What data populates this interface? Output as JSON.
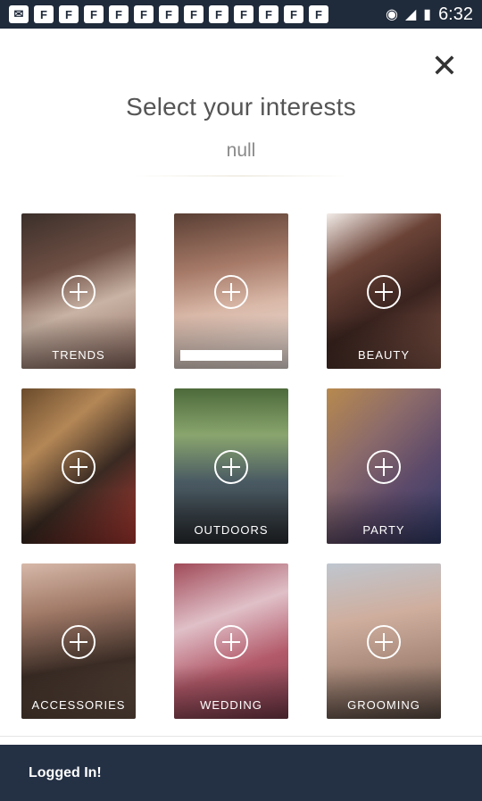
{
  "status_bar": {
    "time": "6:32",
    "notification_icons": [
      "mail-icon",
      "flipboard-icon",
      "flipboard-icon",
      "flipboard-icon",
      "flipboard-icon",
      "flipboard-icon",
      "flipboard-icon",
      "flipboard-icon",
      "flipboard-icon",
      "flipboard-icon",
      "flipboard-icon",
      "flipboard-icon",
      "flipboard-icon",
      "flipboard-icon"
    ],
    "system_icons": [
      "wifi-icon",
      "signal-icon",
      "battery-icon"
    ]
  },
  "header": {
    "close_icon": "close-icon",
    "title": "Select your interests",
    "subtitle": "null"
  },
  "interests": [
    {
      "label": "TRENDS"
    },
    {
      "label": ""
    },
    {
      "label": "BEAUTY"
    },
    {
      "label": ""
    },
    {
      "label": "OUTDOORS"
    },
    {
      "label": "PARTY"
    },
    {
      "label": "ACCESSORIES"
    },
    {
      "label": "WEDDING"
    },
    {
      "label": "GROOMING"
    }
  ],
  "snackbar": {
    "message": "Logged In!"
  }
}
